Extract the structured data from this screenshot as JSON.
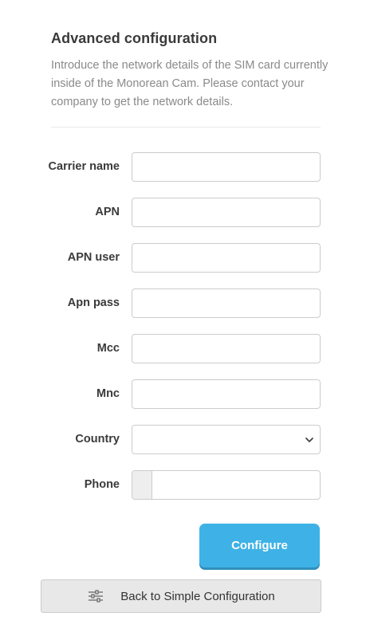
{
  "header": {
    "title": "Advanced configuration",
    "intro": "Introduce the network details of the SIM card currently inside of the Monorean Cam. Please contact your company to get the network details."
  },
  "form": {
    "fields": [
      {
        "label": "Carrier name",
        "value": ""
      },
      {
        "label": "APN",
        "value": ""
      },
      {
        "label": "APN user",
        "value": ""
      },
      {
        "label": "Apn pass",
        "value": ""
      },
      {
        "label": "Mcc",
        "value": ""
      },
      {
        "label": "Mnc",
        "value": ""
      }
    ],
    "country": {
      "label": "Country",
      "selected": ""
    },
    "phone": {
      "label": "Phone",
      "prefix": "",
      "value": ""
    }
  },
  "actions": {
    "configure_label": "Configure",
    "back_label": "Back to Simple Configuration",
    "back_icon": "sliders-icon",
    "configure_color": "#3eb2e6"
  }
}
